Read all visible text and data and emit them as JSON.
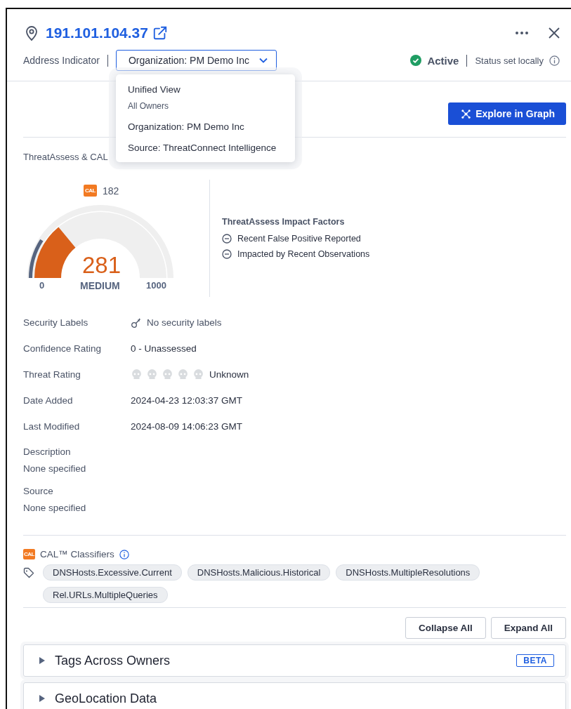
{
  "header": {
    "address": "191.101.104.37",
    "type_label": "Address Indicator",
    "owner_select": "Organization: PM Demo Inc",
    "status": "Active",
    "status_note": "Status set locally"
  },
  "owner_menu": [
    {
      "label": "Unified View",
      "sublabel": "All Owners"
    },
    {
      "label": "Organization: PM Demo Inc"
    },
    {
      "label": "Source: ThreatConnect Intelligence"
    }
  ],
  "explore_button": "Explore in Graph",
  "threat_section": {
    "title": "ThreatAssess & CAL",
    "cal": {
      "badge": "CAL",
      "score": "182"
    },
    "score": "281",
    "rating": "MEDIUM",
    "min": "0",
    "max": "1000",
    "factors_title": "ThreatAssess Impact Factors",
    "factors": [
      "Recent False Positive Reported",
      "Impacted by Recent Observations"
    ]
  },
  "details": [
    {
      "label": "Security Labels",
      "kind": "labels",
      "value": "No security labels"
    },
    {
      "label": "Confidence Rating",
      "kind": "text",
      "value": "0 - Unassessed"
    },
    {
      "label": "Threat Rating",
      "kind": "rating",
      "stars": 0,
      "value": "Unknown"
    },
    {
      "label": "Date Added",
      "kind": "text",
      "value": "2024-04-23 12:03:37 GMT"
    },
    {
      "label": "Last Modified",
      "kind": "text",
      "value": "2024-08-09 14:06:23 GMT"
    },
    {
      "label": "Description",
      "kind": "block",
      "value": "None specified"
    },
    {
      "label": "Source",
      "kind": "block",
      "value": "None specified"
    }
  ],
  "classifiers": {
    "cal_badge": "CAL",
    "title": "CAL™ Classifiers",
    "tags": [
      "DNSHosts.Excessive.Current",
      "DNSHosts.Malicious.Historical",
      "DNSHosts.MultipleResolutions",
      "Rel.URLs.MultipleQueries"
    ]
  },
  "actions": [
    "Collapse All",
    "Expand All"
  ],
  "sections": [
    {
      "title": "Tags Across Owners",
      "badge": "BETA",
      "expanded": false
    },
    {
      "title": "GeoLocation Data",
      "expanded": false
    }
  ]
}
